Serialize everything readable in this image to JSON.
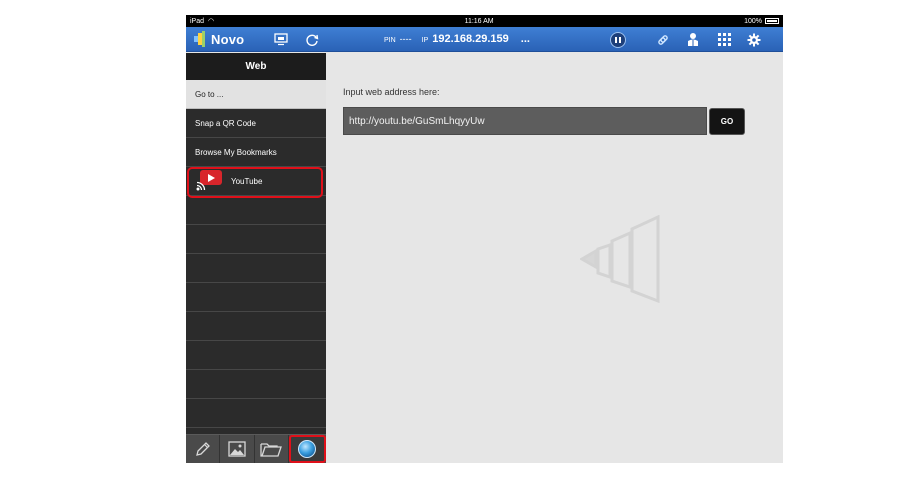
{
  "status_bar": {
    "device": "iPad",
    "time": "11:16 AM",
    "battery": "100%"
  },
  "top_bar": {
    "brand": "Novo",
    "pin_label": "PIN",
    "pin_value": "----",
    "ip_label": "IP",
    "ip_value": "192.168.29.159",
    "more": "...",
    "icons": [
      "screen-share-icon",
      "refresh-icon",
      "pause-icon",
      "link-icon",
      "user-icon",
      "grid-icon",
      "gear-icon"
    ]
  },
  "sidebar": {
    "title": "Web",
    "items": [
      {
        "label": "Go to ...",
        "selected": true
      },
      {
        "label": "Snap a QR Code"
      },
      {
        "label": "Browse My Bookmarks"
      },
      {
        "label": "YouTube",
        "icon": "youtube-cast-icon",
        "highlighted": true
      }
    ],
    "bottom_tabs": [
      "pen-icon",
      "image-icon",
      "folder-icon",
      "globe-icon"
    ],
    "active_tab": "globe-icon"
  },
  "content": {
    "prompt": "Input web address here:",
    "url_value": "http://youtu.be/GuSmLhqyyUw",
    "go_label": "GO"
  },
  "colors": {
    "accent": "#2f6cc4",
    "highlight": "#e0101a",
    "sidebar": "#2b2b2b"
  }
}
